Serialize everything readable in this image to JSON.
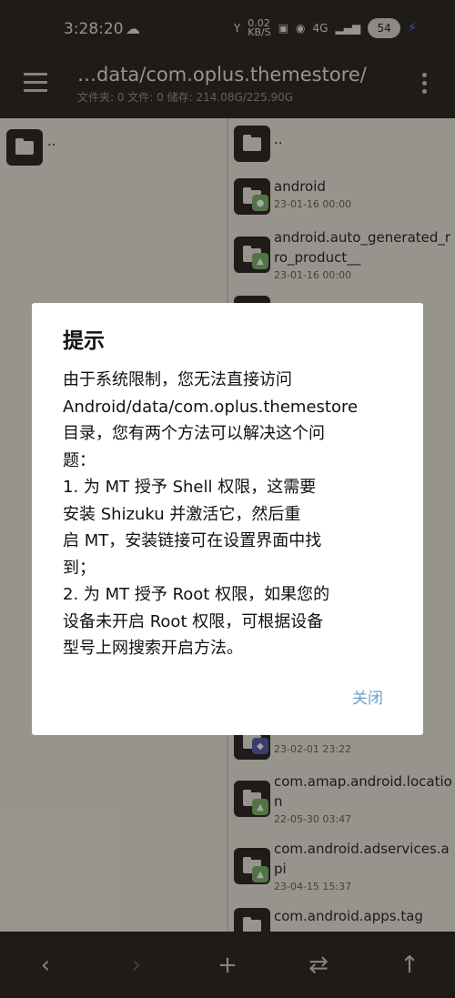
{
  "status": {
    "time": "3:28:20",
    "net_speed": "0.02",
    "net_unit": "KB/S",
    "net_gen": "4G",
    "battery": "54"
  },
  "toolbar": {
    "path": "…data/com.oplus.themestore/",
    "info": "文件夹: 0   文件: 0   储存: 214.08G/225.90G"
  },
  "left_pane": {
    "parent": ".."
  },
  "right_pane": {
    "parent": "..",
    "items": [
      {
        "name": "android",
        "date": "23-01-16 00:00"
      },
      {
        "name": "android.auto_generated_rro_product__",
        "date": "23-01-16 00:00"
      },
      {
        "name": "com.amap.android.location",
        "date": "22-05-30 03:47"
      },
      {
        "name": "com.android.adservices.api",
        "date": "23-04-15 15:37"
      },
      {
        "name": "com.android.apps.tag",
        "date": ""
      }
    ],
    "partial_date": "23-02-01 23:22"
  },
  "dialog": {
    "title": "提示",
    "lines": [
      "由于系统限制，您无法直接访问",
      "Android/data/com.oplus.themestore",
      "目录，您有两个方法可以解决这个问",
      "题：",
      "1. 为 MT 授予 Shell 权限，这需要",
      "安装 Shizuku 并激活它，然后重",
      "启 MT，安装链接可在设置界面中找",
      "到；",
      "2. 为 MT 授予 Root 权限，如果您的",
      "设备未开启 Root 权限，可根据设备",
      "型号上网搜索开启方法。"
    ],
    "close_label": "关闭"
  },
  "bottom_bar": {
    "back": "‹",
    "forward": "›",
    "add": "+",
    "swap": "⇄",
    "up": "↑"
  }
}
